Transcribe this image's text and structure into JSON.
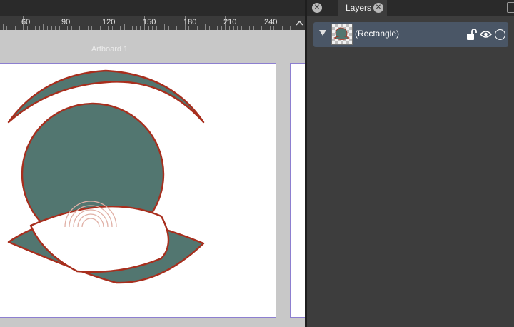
{
  "ruler": {
    "labels": [
      "60",
      "90",
      "120",
      "150",
      "180",
      "210",
      "240"
    ]
  },
  "artboard": {
    "label": "Artboard 1"
  },
  "panel": {
    "tab_label": "Layers",
    "close_glyph": "✕",
    "layers": [
      {
        "name": "(Rectangle)",
        "locked": false,
        "visible": true,
        "expanded": true
      }
    ]
  },
  "colors": {
    "fill": "#527670",
    "stroke": "#a82e1d",
    "selection": "#4a5666"
  },
  "icons": [
    "close-icon",
    "grip-icon",
    "panel-menu-icon",
    "expand-arrow-icon",
    "lock-open-icon",
    "eye-icon",
    "visibility-circle-icon"
  ]
}
